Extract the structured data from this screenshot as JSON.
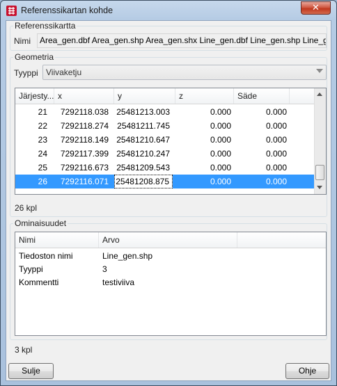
{
  "window": {
    "title": "Referenssikartan kohde",
    "close_symbol": "✕"
  },
  "reference_map": {
    "legend": "Referenssikartta",
    "name_label": "Nimi",
    "name_value": "Area_gen.dbf Area_gen.shp Area_gen.shx Line_gen.dbf Line_gen.shp Line_gen"
  },
  "geometry": {
    "legend": "Geometria",
    "type_label": "Tyyppi",
    "type_value": "Viivaketju",
    "columns": [
      "Järjesty...",
      "x",
      "y",
      "z",
      "Säde"
    ],
    "rows": [
      {
        "n": "21",
        "x": "7292118.038",
        "y": "25481213.003",
        "z": "0.000",
        "sade": "0.000"
      },
      {
        "n": "22",
        "x": "7292118.274",
        "y": "25481211.745",
        "z": "0.000",
        "sade": "0.000"
      },
      {
        "n": "23",
        "x": "7292118.149",
        "y": "25481210.647",
        "z": "0.000",
        "sade": "0.000"
      },
      {
        "n": "24",
        "x": "7292117.399",
        "y": "25481210.247",
        "z": "0.000",
        "sade": "0.000"
      },
      {
        "n": "25",
        "x": "7292116.673",
        "y": "25481209.543",
        "z": "0.000",
        "sade": "0.000"
      },
      {
        "n": "26",
        "x": "7292116.071",
        "y": "25481208.875",
        "z": "0.000",
        "sade": "0.000"
      }
    ],
    "selected_row": "26",
    "count": "26 kpl"
  },
  "attributes": {
    "legend": "Ominaisuudet",
    "columns": [
      "Nimi",
      "Arvo"
    ],
    "rows": [
      {
        "name": "Tiedoston nimi",
        "value": "Line_gen.shp"
      },
      {
        "name": "Tyyppi",
        "value": "3"
      },
      {
        "name": "Kommentti",
        "value": "testiviiva"
      }
    ],
    "count": "3 kpl"
  },
  "buttons": {
    "close": "Sulje",
    "help": "Ohje"
  },
  "colors": {
    "selection": "#3399ff",
    "close_button": "#c0391f"
  }
}
